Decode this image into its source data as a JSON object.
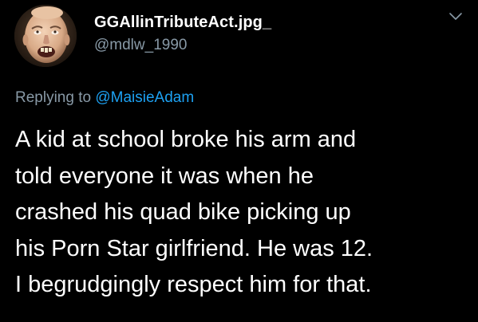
{
  "colors": {
    "background": "#000000",
    "text": "#ffffff",
    "secondary_text": "#8899a6",
    "mention": "#1da1f2"
  },
  "user": {
    "display_name": "GGAllinTributeAct.jpg_",
    "handle": "@mdlw_1990",
    "avatar_icon": "profile-photo"
  },
  "menu": {
    "icon": "chevron-down-icon"
  },
  "reply": {
    "prefix": "Replying to ",
    "mention": "@MaisieAdam"
  },
  "tweet": {
    "lines": [
      "A kid at school broke his arm and",
      "told everyone it was when he",
      "crashed his quad bike picking up",
      "his Porn Star girlfriend. He was 12.",
      "I begrudgingly respect him for that."
    ]
  }
}
